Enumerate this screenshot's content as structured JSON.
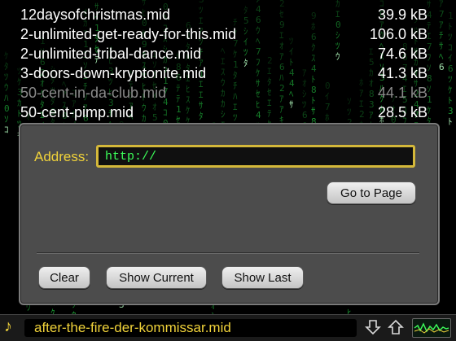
{
  "files": [
    {
      "name": "12daysofchristmas.mid",
      "size": "39.9 kB",
      "dim": false
    },
    {
      "name": "2-unlimited-get-ready-for-this.mid",
      "size": "106.0 kB",
      "dim": false
    },
    {
      "name": "2-unlimited-tribal-dance.mid",
      "size": "74.6 kB",
      "dim": false
    },
    {
      "name": "3-doors-down-kryptonite.mid",
      "size": "41.3 kB",
      "dim": false
    },
    {
      "name": "50-cent-in-da-club.mid",
      "size": "44.1 kB",
      "dim": true
    },
    {
      "name": "50-cent-pimp.mid",
      "size": "28.5 kB",
      "dim": false
    }
  ],
  "dialog": {
    "address_label": "Address:",
    "address_value": "http://",
    "go_label": "Go to Page",
    "clear_label": "Clear",
    "show_current_label": "Show Current",
    "show_last_label": "Show Last"
  },
  "status": {
    "note_icon": "music-note-icon",
    "track": "after-the-fire-der-kommissar.mid"
  },
  "colors": {
    "accent_yellow": "#f0d23a",
    "matrix_green": "#1fae3a",
    "input_text_green": "#3cff5a",
    "panel_gray": "#4c4c4c"
  }
}
